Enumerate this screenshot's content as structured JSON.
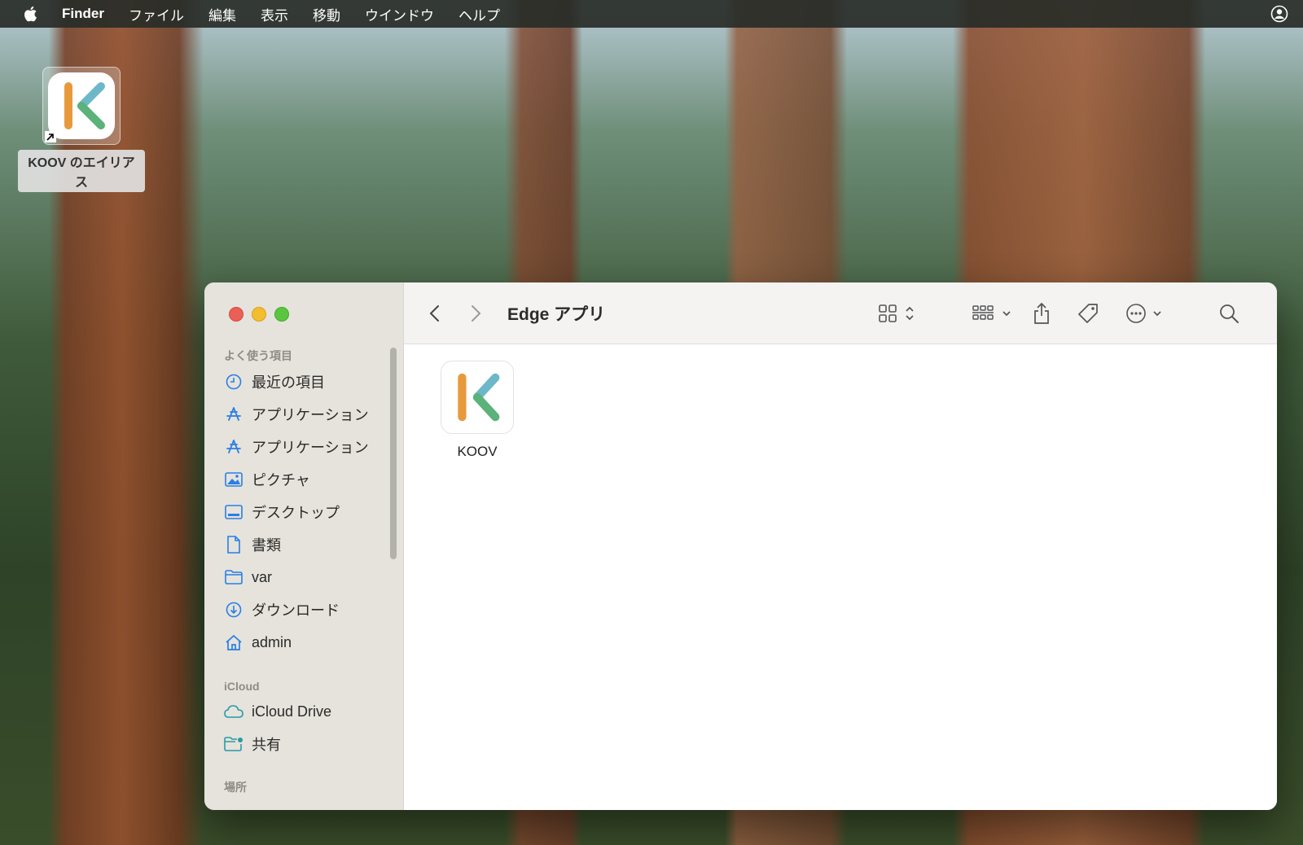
{
  "menubar": {
    "items": [
      "Finder",
      "ファイル",
      "編集",
      "表示",
      "移動",
      "ウインドウ",
      "ヘルプ"
    ]
  },
  "desktop": {
    "alias_label": "KOOV のエイリアス"
  },
  "finder": {
    "title": "Edge アプリ",
    "sidebar": {
      "favorites_heading": "よく使う項目",
      "favorites": [
        {
          "label": "最近の項目",
          "icon": "clock-icon"
        },
        {
          "label": "アプリケーション",
          "icon": "apps-icon"
        },
        {
          "label": "アプリケーション",
          "icon": "apps-icon"
        },
        {
          "label": "ピクチャ",
          "icon": "photo-icon"
        },
        {
          "label": "デスクトップ",
          "icon": "desktop-icon"
        },
        {
          "label": "書類",
          "icon": "document-icon"
        },
        {
          "label": "var",
          "icon": "folder-icon"
        },
        {
          "label": "ダウンロード",
          "icon": "download-icon"
        },
        {
          "label": "admin",
          "icon": "home-icon"
        }
      ],
      "icloud_heading": "iCloud",
      "icloud": [
        {
          "label": "iCloud Drive",
          "icon": "cloud-icon"
        },
        {
          "label": "共有",
          "icon": "shared-folder-icon"
        }
      ],
      "places_heading": "場所"
    },
    "files": [
      {
        "name": "KOOV"
      }
    ]
  },
  "colors": {
    "accent": "#2a7ee6",
    "koov_orange": "#e79a3c",
    "koov_teal": "#6cb8c9",
    "koov_green": "#5bb27a"
  }
}
